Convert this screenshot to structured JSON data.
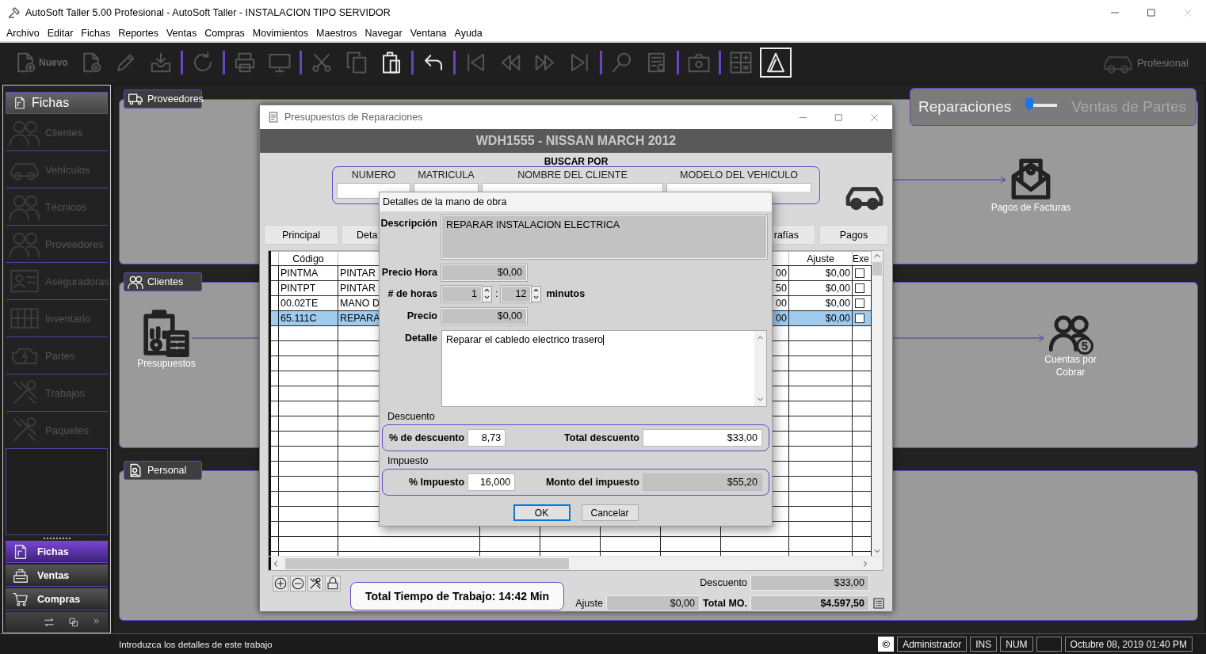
{
  "window": {
    "title": "AutoSoft Taller 5.00 Profesional - AutoSoft Taller - INSTALACION TIPO SERVIDOR"
  },
  "menu": [
    "Archivo",
    "Editar",
    "Fichas",
    "Reportes",
    "Ventas",
    "Compras",
    "Movimientos",
    "Maestros",
    "Navegar",
    "Ventana",
    "Ayuda"
  ],
  "toolbar": {
    "buttons": [
      {
        "kind": "button",
        "label": "Nuevo",
        "disabled": true,
        "selected": false
      },
      {
        "kind": "button",
        "disabled": true,
        "selected": false
      },
      {
        "kind": "button",
        "disabled": true,
        "selected": false
      },
      {
        "kind": "button",
        "disabled": true,
        "selected": false
      },
      {
        "kind": "separator"
      },
      {
        "kind": "button",
        "disabled": true,
        "selected": false
      },
      {
        "kind": "separator"
      },
      {
        "kind": "button",
        "disabled": true,
        "selected": false
      },
      {
        "kind": "button",
        "disabled": true,
        "selected": false
      },
      {
        "kind": "separator"
      },
      {
        "kind": "button",
        "disabled": true,
        "selected": false
      },
      {
        "kind": "button",
        "disabled": true,
        "selected": false
      },
      {
        "kind": "button",
        "disabled": false,
        "selected": false
      },
      {
        "kind": "separator"
      },
      {
        "kind": "button",
        "disabled": false,
        "selected": false
      },
      {
        "kind": "separator"
      },
      {
        "kind": "button",
        "disabled": true,
        "selected": false
      },
      {
        "kind": "button",
        "disabled": true,
        "selected": false
      },
      {
        "kind": "button",
        "disabled": true,
        "selected": false
      },
      {
        "kind": "button",
        "disabled": true,
        "selected": false
      },
      {
        "kind": "separator"
      },
      {
        "kind": "button",
        "disabled": true,
        "selected": false
      },
      {
        "kind": "button",
        "disabled": true,
        "selected": false
      },
      {
        "kind": "separator"
      },
      {
        "kind": "button",
        "disabled": true,
        "selected": false
      },
      {
        "kind": "separator"
      },
      {
        "kind": "button",
        "disabled": true,
        "selected": false
      },
      {
        "kind": "button",
        "disabled": false,
        "selected": true
      }
    ],
    "edition": "Profesional"
  },
  "sidebar": {
    "title": "Fichas",
    "items": [
      {
        "label": "Clientes",
        "disabled": true
      },
      {
        "label": "Vehículos",
        "disabled": true
      },
      {
        "label": "Técnicos",
        "disabled": true
      },
      {
        "label": "Proveedores",
        "disabled": true
      },
      {
        "label": "Aseguradoras",
        "disabled": true
      },
      {
        "label": "Inventario",
        "disabled": true
      },
      {
        "label": "Partes",
        "disabled": true
      },
      {
        "label": "Trabajos",
        "disabled": true
      },
      {
        "label": "Paquetes",
        "disabled": true
      }
    ],
    "nav": [
      {
        "label": "Fichas",
        "selected": true
      },
      {
        "label": "Ventas",
        "selected": false
      },
      {
        "label": "Compras",
        "selected": false
      }
    ]
  },
  "mode_switch": [
    {
      "label": "Reparaciones",
      "selected": true
    },
    {
      "label": "Ventas de Partes",
      "selected": false
    }
  ],
  "groups": [
    {
      "label": "Proveedores",
      "nodes": [
        {
          "label": "Pagos de Facturas"
        }
      ]
    },
    {
      "label": "Clientes",
      "nodes": [
        {
          "label": "Presupuestos"
        },
        {
          "label": "Cuentas por Cobrar",
          "badge": "5"
        }
      ]
    },
    {
      "label": "Personal"
    }
  ],
  "budget_window": {
    "title": "Presupuestos de Reparaciones",
    "vehicle": "WDH1555 - NISSAN MARCH 2012",
    "search": {
      "title": "BUSCAR POR",
      "fields": [
        "NUMERO",
        "MATRICULA",
        "NOMBRE DEL CLIENTE",
        "MODELO DEL VEHICULO"
      ]
    },
    "tabs": [
      {
        "label": "Principal",
        "selected": false
      },
      {
        "label": "Deta",
        "selected": false
      },
      {
        "label": "rafías",
        "selected": false
      },
      {
        "label": "Pagos",
        "selected": false
      }
    ],
    "table": {
      "columns": [
        "Código",
        "Ajuste",
        "Exe"
      ],
      "rows": [
        {
          "code": "PINTMA",
          "description": "PINTAR",
          "column_3": "00",
          "adjustment": "$0,00",
          "checked": false,
          "selected": false
        },
        {
          "code": "PINTPT",
          "description": "PINTAR",
          "column_3": "50",
          "adjustment": "$0,00",
          "checked": false,
          "selected": false
        },
        {
          "code": "00.02TE",
          "description": "MANO D",
          "column_3": "00",
          "adjustment": "$0,00",
          "checked": false,
          "selected": false
        },
        {
          "code": "65.111C",
          "description": "REPARA",
          "column_3": "00",
          "adjustment": "$0,00",
          "checked": false,
          "selected": true
        }
      ]
    },
    "work_time": "Total Tiempo de Trabajo: 14:42 Min",
    "totals": {
      "discount_label": "Descuento",
      "discount": "$33,00",
      "adjustment_label": "Ajuste",
      "adjustment": "$0,00",
      "total_label": "Total MO.",
      "total": "$4.597,50"
    }
  },
  "labor_dialog": {
    "title": "Detalles de la mano de obra",
    "description_label": "Descripción",
    "description": "REPARAR INSTALACION ELECTRICA",
    "hour_price_label": "Precio Hora",
    "hour_price": "$0,00",
    "hours_label": "# de horas",
    "hours": "1",
    "separator": ":",
    "minutes": "12",
    "minutes_label": "minutos",
    "price_label": "Precio",
    "price": "$0,00",
    "detail_label": "Detalle",
    "detail": "Reparar el cabledo electrico trasero",
    "discount_title": "Descuento",
    "discount_pct_label": "% de descuento",
    "discount_pct": "8,73",
    "discount_total_label": "Total descuento",
    "discount_total": "$33,00",
    "tax_title": "Impuesto",
    "tax_pct_label": "% Impuesto",
    "tax_pct": "16,000",
    "tax_amount_label": "Monto del impuesto",
    "tax_amount": "$55,20",
    "buttons": [
      "OK",
      "Cancelar"
    ]
  },
  "status_bar": {
    "message": "Introduzca los detalles de este trabajo",
    "copyright": "©",
    "user": "Administrador",
    "ins": "INS",
    "num": "NUM",
    "datetime": "Octubre 08, 2019 01:40 PM"
  }
}
